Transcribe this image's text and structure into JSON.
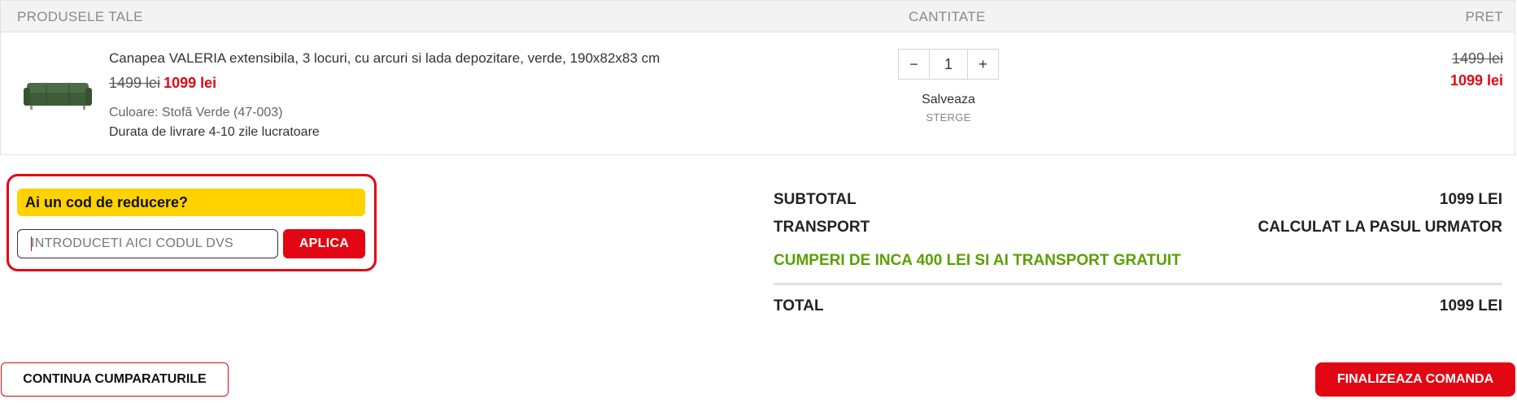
{
  "cart_header": {
    "products": "PRODUSELE TALE",
    "quantity": "CANTITATE",
    "price": "PRET"
  },
  "item": {
    "name": "Canapea VALERIA extensibila, 3 locuri, cu arcuri si lada depozitare, verde, 190x82x83 cm",
    "old_price": "1499 lei",
    "new_price": "1099 lei",
    "color": "Culoare: Stofă Verde (47-003)",
    "delivery": "Durata de livrare 4-10 zile lucratoare",
    "quantity": "1",
    "decrement": "−",
    "increment": "+",
    "save_label": "Salveaza",
    "delete_label": "STERGE",
    "total_old": "1499 lei",
    "total_new": "1099 lei"
  },
  "coupon": {
    "title": "Ai un cod de reducere?",
    "placeholder": "INTRODUCETI AICI CODUL DVS",
    "apply": "APLICA"
  },
  "totals": {
    "subtotal_label": "SUBTOTAL",
    "subtotal_value": "1099 LEI",
    "transport_label": "TRANSPORT",
    "transport_value": "CALCULAT LA PASUL URMATOR",
    "free_shipping_msg": "CUMPERI DE INCA 400 LEI SI AI TRANSPORT GRATUIT",
    "total_label": "TOTAL",
    "total_value": "1099 LEI"
  },
  "actions": {
    "continue": "CONTINUA CUMPARATURILE",
    "finalize": "FINALIZEAZA COMANDA"
  },
  "colors": {
    "accent_red": "#e30613",
    "coupon_yellow": "#ffd200",
    "free_shipping_green": "#5aa000"
  }
}
